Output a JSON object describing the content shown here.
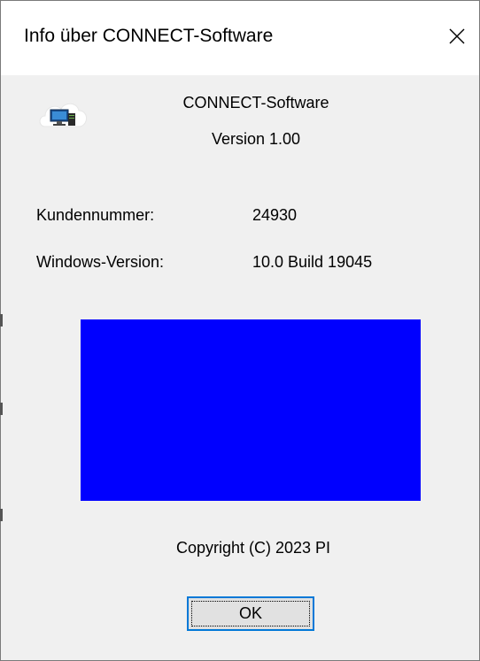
{
  "window": {
    "title": "Info über CONNECT-Software",
    "close_glyph": "✕",
    "close_icon": "close-icon"
  },
  "app": {
    "icon": "computer-cloud-icon",
    "product_name": "CONNECT-Software",
    "version_text": "Version 1.00"
  },
  "info": {
    "customer_number_label": "Kundennummer:",
    "customer_number_value": "24930",
    "windows_version_label": "Windows-Version:",
    "windows_version_value": "10.0 Build 19045"
  },
  "panel": {
    "color": "#0000ff"
  },
  "footer": {
    "copyright": "Copyright (C) 2023 PI",
    "ok_label": "OK"
  },
  "colors": {
    "focus_border": "#0078d7",
    "background": "#f0f0f0"
  }
}
